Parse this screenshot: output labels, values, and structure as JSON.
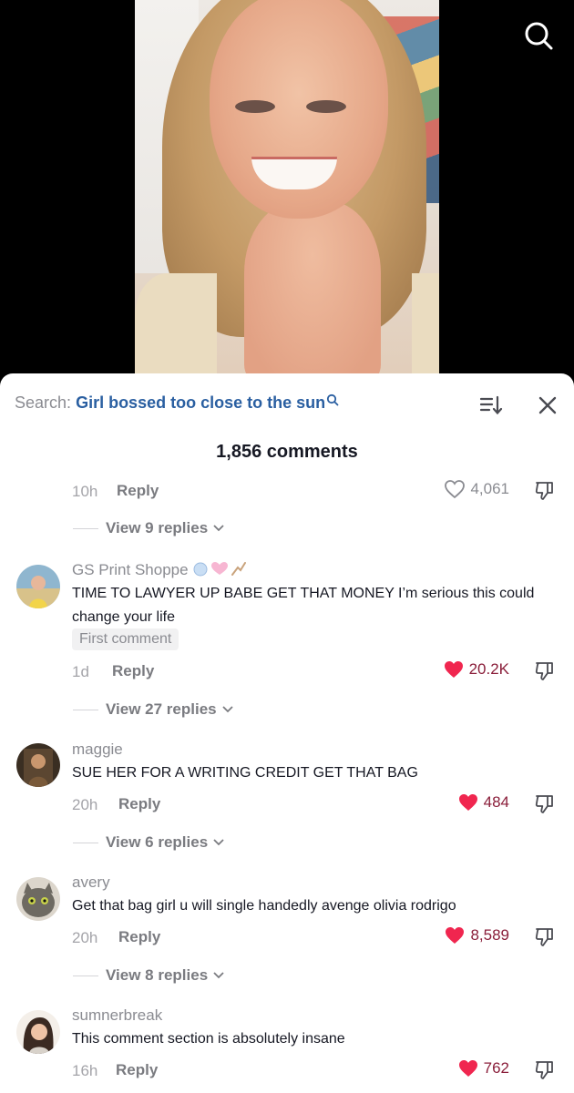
{
  "search_suggestion": {
    "prefix": "Search:",
    "term": "Girl bossed too close to the sun"
  },
  "comment_count": "1,856 comments",
  "top_partial": {
    "time": "10h",
    "reply_label": "Reply",
    "likes": "4,061",
    "view_replies": "View 9 replies"
  },
  "comments": [
    {
      "username": "GS Print Shoppe",
      "text": "TIME TO LAWYER UP BABE GET THAT MONEY I’m serious this could change your life",
      "badge": "First comment",
      "time": "1d",
      "reply_label": "Reply",
      "likes": "20.2K",
      "view_replies": "View 27 replies"
    },
    {
      "username": "maggie",
      "text": "SUE HER FOR A WRITING CREDIT GET THAT BAG",
      "time": "20h",
      "reply_label": "Reply",
      "likes": "484",
      "view_replies": "View 6 replies"
    },
    {
      "username": "avery",
      "text": "Get that bag girl u will single handedly avenge olivia rodrigo",
      "time": "20h",
      "reply_label": "Reply",
      "likes": "8,589",
      "view_replies": "View 8 replies"
    },
    {
      "username": "sumnerbreak",
      "text": "This comment section is absolutely insane",
      "time": "16h",
      "reply_label": "Reply",
      "likes": "762"
    }
  ],
  "colors": {
    "liked_heart": "#f0264f",
    "search_term": "#2a5fa1"
  },
  "icons": [
    "search-icon",
    "sort-icon",
    "close-icon",
    "heart-outline-icon",
    "heart-filled-icon",
    "dislike-icon",
    "chevron-down-icon"
  ]
}
